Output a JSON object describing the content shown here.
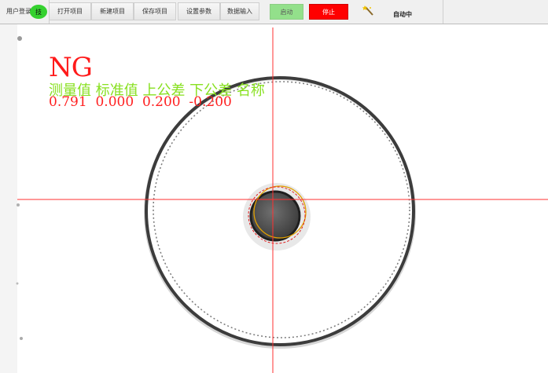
{
  "toolbar": {
    "login_label": "用户登录",
    "badge_label": "技",
    "open_label": "打开项目",
    "new_label": "新建项目",
    "save_label": "保存项目",
    "settings_label": "设置参数",
    "data_input_label": "数据输入",
    "start_label": "启动",
    "stop_label": "停止",
    "auto_status": "自动中",
    "auto_icon": "wand-icon"
  },
  "colors": {
    "badge_green": "#35d12f",
    "start_green": "#93e08b",
    "stop_red": "#ff0000",
    "ng_red": "#ff1a1a",
    "header_green": "#88e020",
    "values_red": "#ff2020",
    "crosshair": "#ff3030"
  },
  "result": {
    "status": "NG",
    "headers": "测量值 标准值 上公差 下公差 名称",
    "values": "0.791  0.000  0.200  -0.200"
  }
}
